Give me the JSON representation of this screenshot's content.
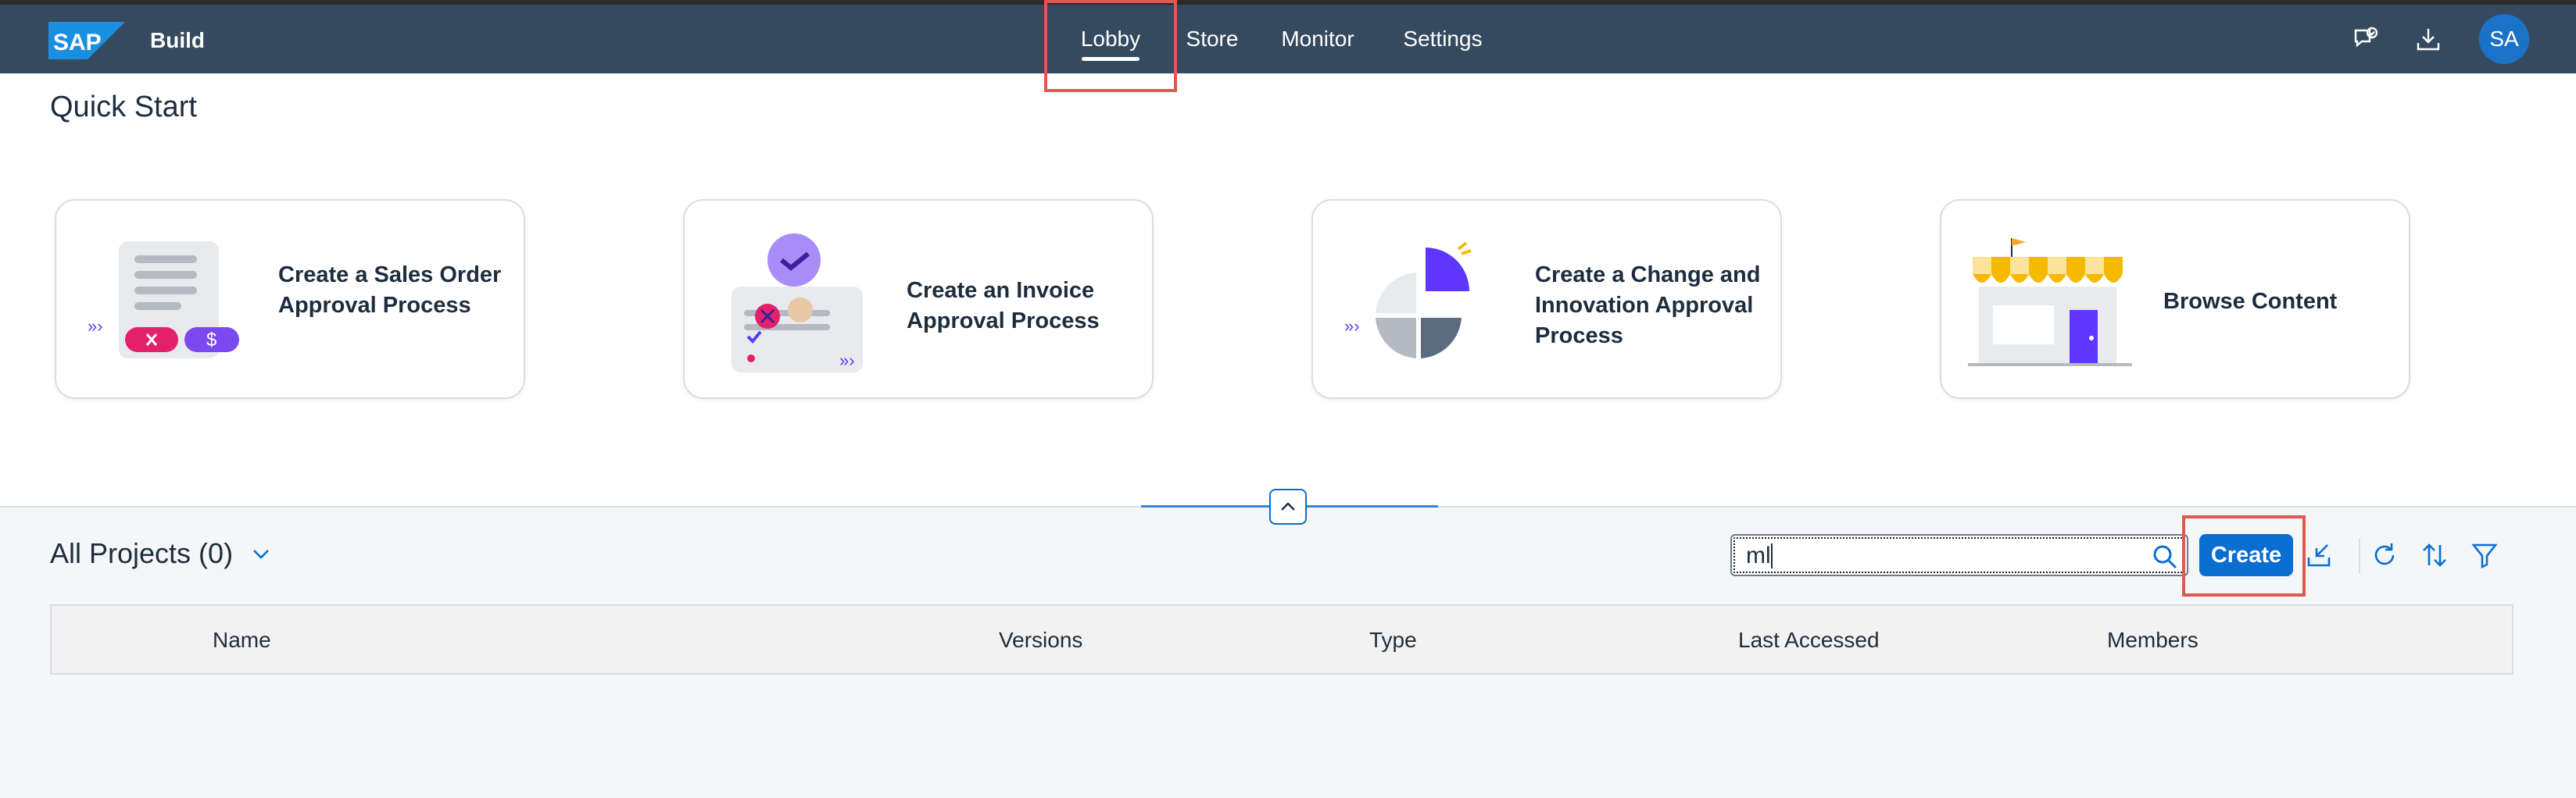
{
  "shell": {
    "logo_text": "SAP",
    "product": "Build",
    "nav": [
      "Lobby",
      "Store",
      "Monitor",
      "Settings"
    ],
    "active_nav": "Lobby",
    "avatar_initials": "SA",
    "icons": [
      "feedback-icon",
      "download-icon"
    ]
  },
  "quick_start": {
    "title": "Quick Start",
    "cards": [
      {
        "title": "Create a Sales Order Approval Process",
        "icon": "sales-order-illustration"
      },
      {
        "title": "Create an Invoice Approval Process",
        "icon": "invoice-illustration"
      },
      {
        "title": "Create a Change and Innovation Approval Process",
        "icon": "pie-chart-illustration"
      },
      {
        "title": "Browse Content",
        "icon": "store-illustration"
      }
    ]
  },
  "projects": {
    "title": "All Projects (0)",
    "search_value": "ml",
    "create_label": "Create",
    "columns": [
      "Name",
      "Versions",
      "Type",
      "Last Accessed",
      "Members"
    ]
  },
  "colors": {
    "shell_bg": "#354a5f",
    "accent": "#0a6ed1",
    "highlight": "#e0584f"
  }
}
